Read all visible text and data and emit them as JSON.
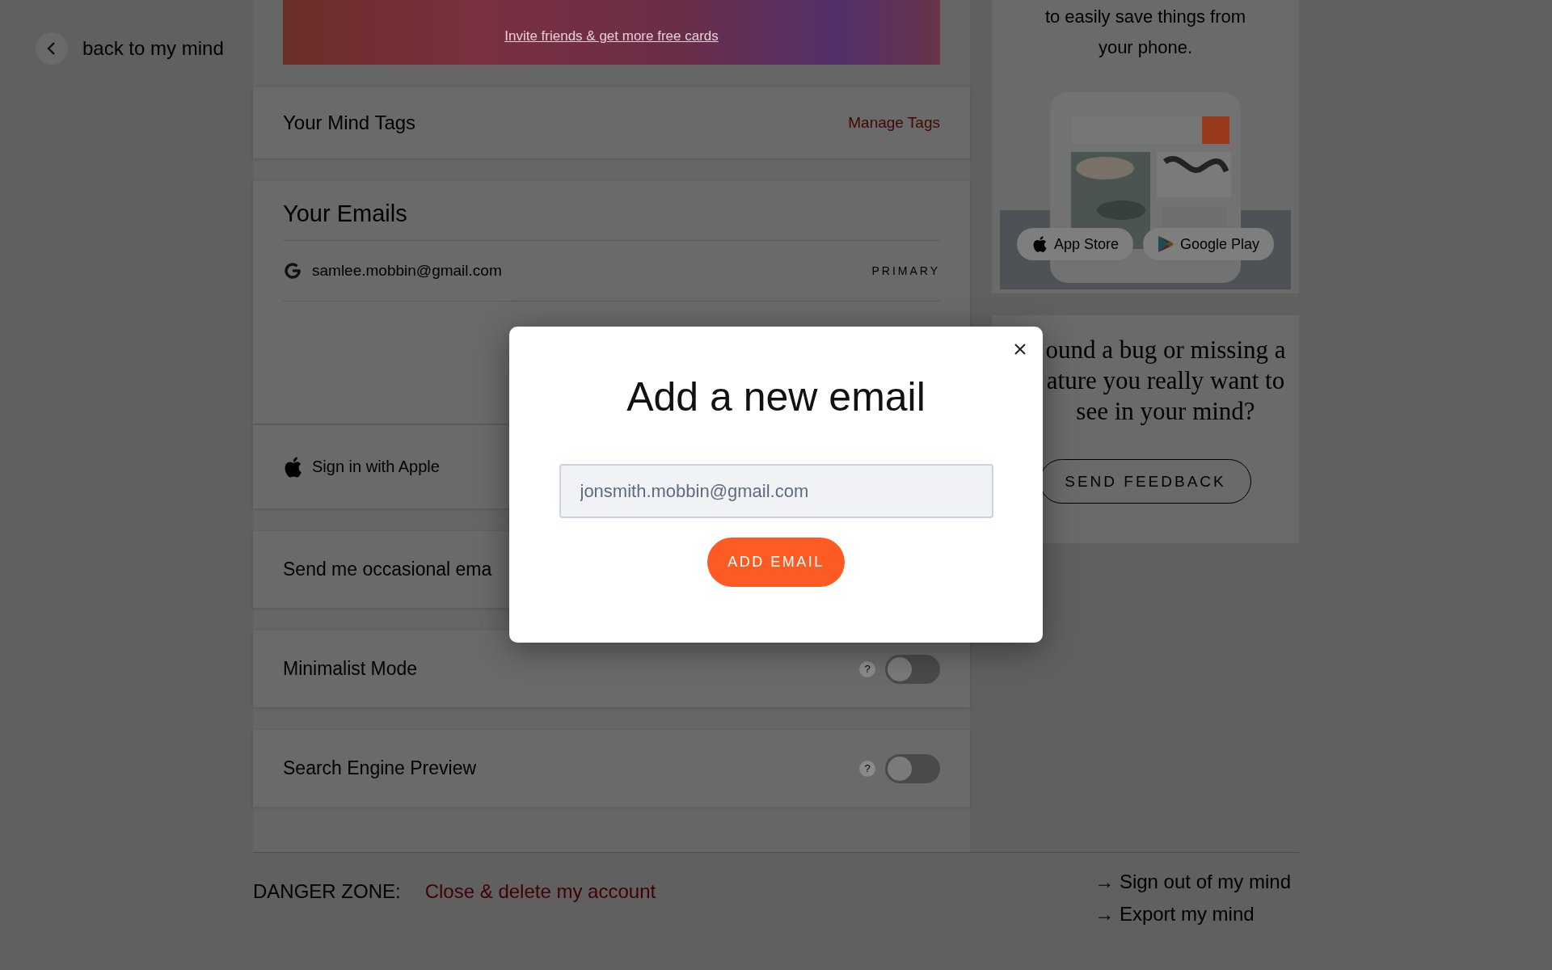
{
  "back_link": {
    "label": "back to my mind"
  },
  "invite_banner": {
    "link": "Invite friends & get more free cards"
  },
  "tags_card": {
    "title": "Your Mind Tags",
    "action": "Manage Tags"
  },
  "emails_card": {
    "title": "Your Emails",
    "emails": [
      {
        "address": "samlee.mobbin@gmail.com",
        "badge": "PRIMARY",
        "kind": "google"
      }
    ]
  },
  "apple_card": {
    "label": "Sign in with Apple"
  },
  "settings": [
    {
      "label": "Send me occasional ema",
      "kind": "plain"
    },
    {
      "label": "Minimalist Mode",
      "kind": "toggle",
      "help": "?",
      "on": false
    },
    {
      "label": "Search Engine Preview",
      "kind": "toggle",
      "help": "?",
      "on": false
    }
  ],
  "danger_zone": {
    "label": "DANGER ZONE:",
    "action": "Close & delete my account"
  },
  "footer_links": [
    "→ Sign out of my mind",
    "→ Export my mind"
  ],
  "app_promo": {
    "text_lines": [
      "to easily save things from",
      "your phone."
    ],
    "buttons": [
      {
        "label": "App Store",
        "kind": "apple"
      },
      {
        "label": "Google Play",
        "kind": "google"
      }
    ]
  },
  "feedback": {
    "lines": [
      "ound a bug or missing a",
      "ature you really want to",
      "see in your mind?"
    ],
    "button": "SEND FEEDBACK"
  },
  "modal": {
    "title": "Add a new email",
    "input_value": "jonsmith.mobbin@gmail.com",
    "button": "ADD EMAIL"
  }
}
